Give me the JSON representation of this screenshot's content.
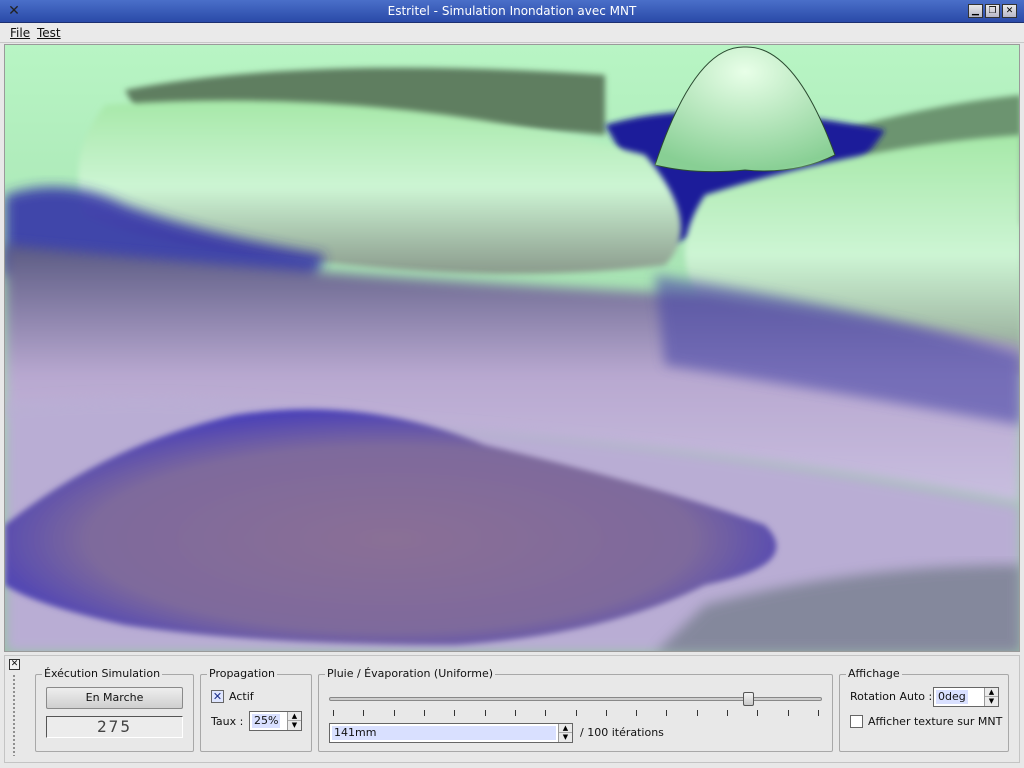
{
  "window": {
    "title": "Estritel - Simulation Inondation avec MNT",
    "app_icon": "x-logo-icon",
    "controls": [
      "minimize-icon",
      "maximize-icon",
      "close-icon"
    ]
  },
  "menu": {
    "file_label": "File",
    "test_label": "Test"
  },
  "viewport": {
    "description": "3D terrain view"
  },
  "panel": {
    "execution": {
      "legend": "Éxécution Simulation",
      "run_button": "En Marche",
      "counter": "275"
    },
    "propagation": {
      "legend": "Propagation",
      "active_label": "Actif",
      "active_checked": true,
      "rate_label": "Taux :",
      "rate_value": "25%"
    },
    "rain": {
      "legend": "Pluie / Évaporation (Uniforme)",
      "slider_fraction": 0.85,
      "amount_value": "141mm",
      "iterations_label": "/ 100 itérations",
      "tick_count": 17
    },
    "display": {
      "legend": "Affichage",
      "rotation_label": "Rotation Auto :",
      "rotation_value": "0deg",
      "texture_label": "Afficher texture sur MNT",
      "texture_checked": false
    }
  },
  "colors": {
    "water": "#3a36b8",
    "land_light": "#a8f0b8",
    "land_dark": "#5f8a64",
    "titlebar": "#3a5cb8"
  }
}
